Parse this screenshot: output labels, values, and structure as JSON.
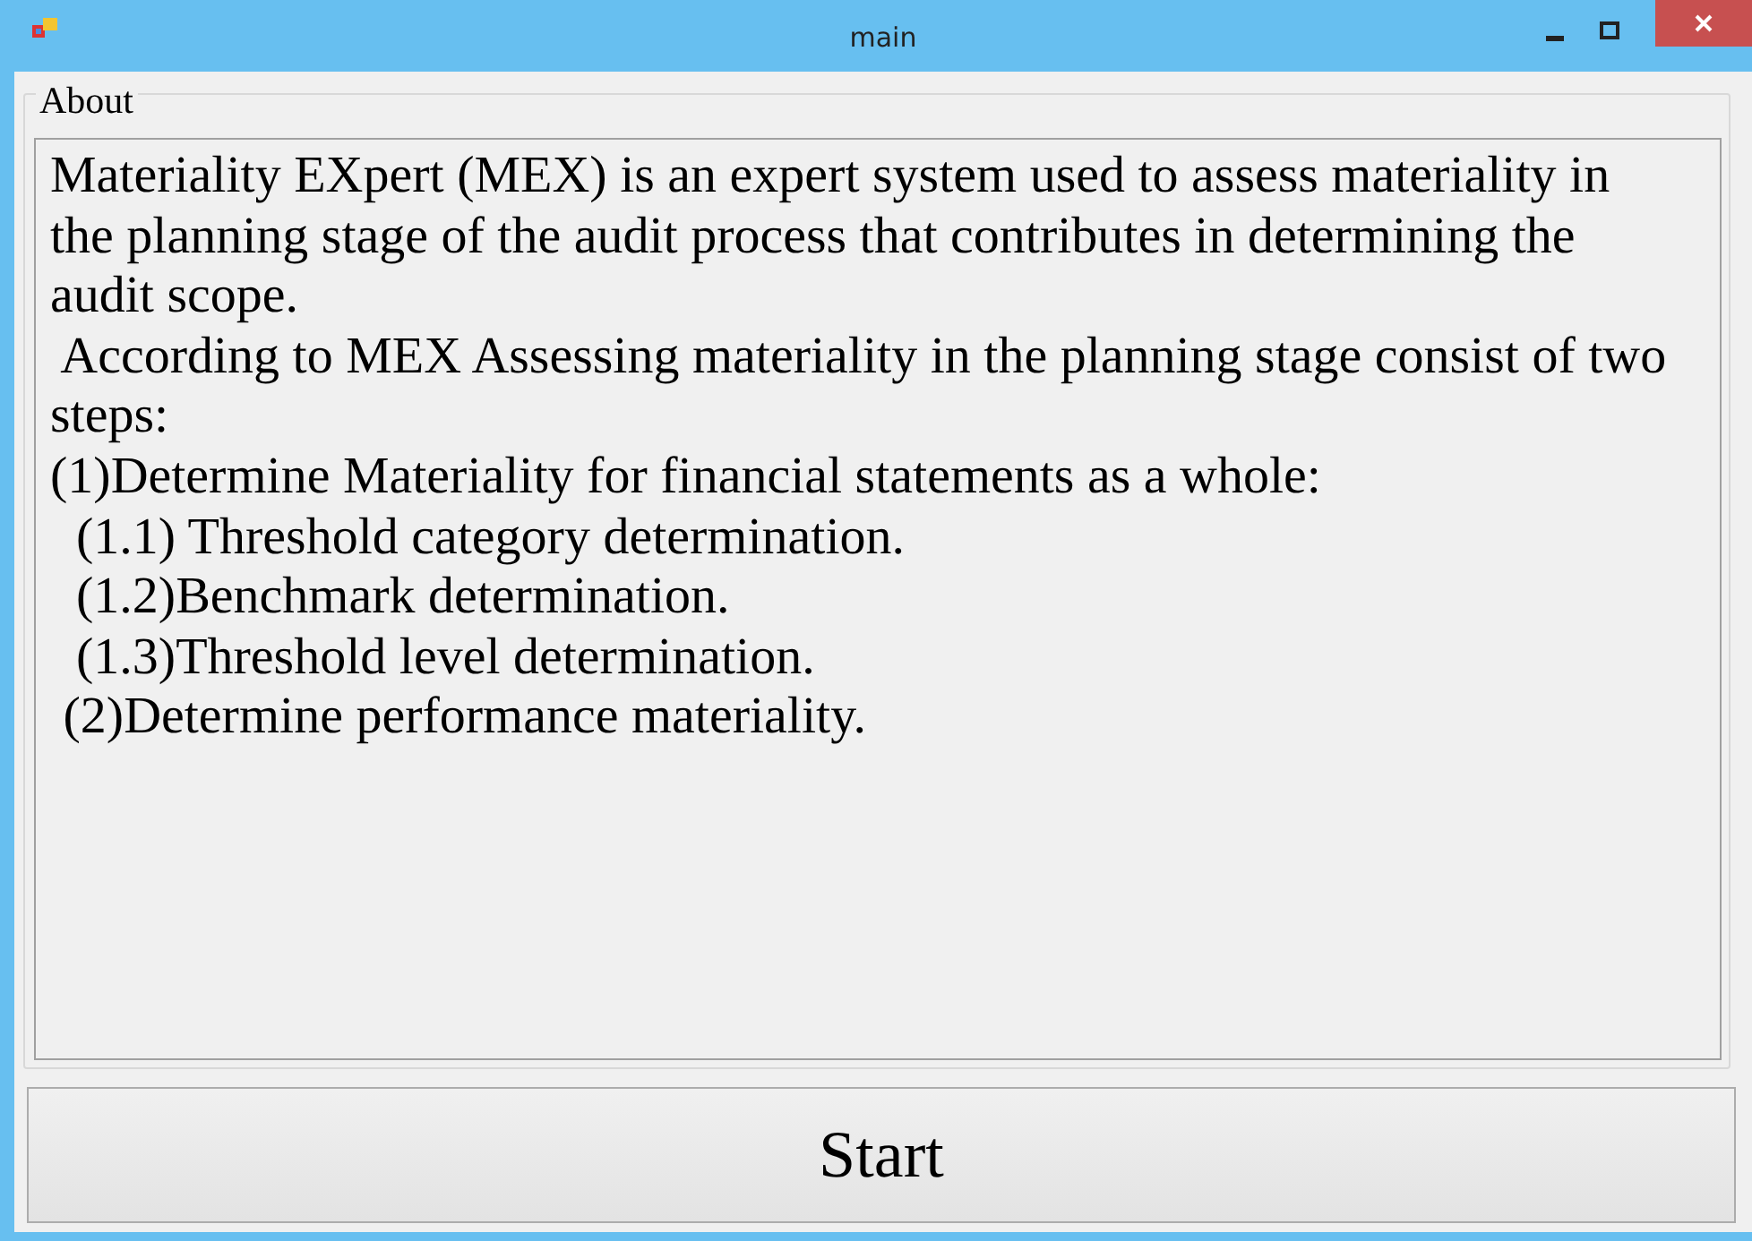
{
  "window": {
    "title": "main"
  },
  "group": {
    "label": "About",
    "lines": [
      "Materiality EXpert (MEX) is an expert system used to assess materiality in",
      "the planning stage of the audit process that contributes in determining the",
      "audit scope.",
      " According to MEX Assessing materiality in the planning stage consist of two",
      "steps:",
      "(1)Determine Materiality for financial statements as a whole:",
      "  (1.1) Threshold category determination.",
      "  (1.2)Benchmark determination.",
      "  (1.3)Threshold level determination.",
      " (2)Determine performance materiality."
    ]
  },
  "buttons": [
    "Start"
  ]
}
